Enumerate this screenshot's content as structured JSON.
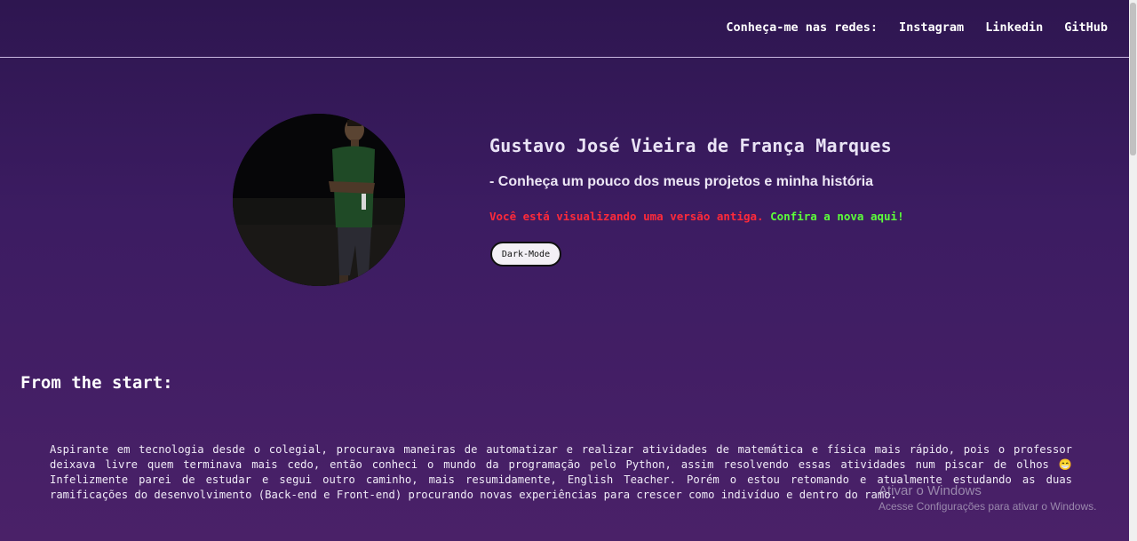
{
  "nav": {
    "label": "Conheça-me nas redes:",
    "links": [
      "Instagram",
      "Linkedin",
      "GitHub"
    ]
  },
  "hero": {
    "name": "Gustavo José Vieira de França Marques",
    "subtitle": "- Conheça um pouco dos meus projetos e minha história",
    "old_version_notice": "Você está visualizando uma versão antiga.",
    "new_version_link": "Confira a nova aqui!",
    "dark_mode_button": "Dark-Mode"
  },
  "about": {
    "title": "From the start:",
    "text": "Aspirante em tecnologia desde o colegial, procurava maneiras de automatizar e realizar atividades de matemática e física mais rápido, pois o professor deixava livre quem terminava mais cedo, então conheci o mundo da programação pelo Python, assim resolvendo essas atividades num piscar de olhos 😁 Infelizmente parei de estudar e segui outro caminho, mais resumidamente, English Teacher. Porém o estou retomando e atualmente estudando as duas ramificações do desenvolvimento (Back-end e Front-end) procurando novas experiências para crescer como indivíduo e dentro do ramo."
  },
  "watermark": {
    "title": "Ativar o Windows",
    "subtitle": "Acesse Configurações para ativar o Windows."
  },
  "colors": {
    "background": "#3c1c62",
    "warning": "#ff2a3a",
    "link_green": "#5cff3a"
  }
}
